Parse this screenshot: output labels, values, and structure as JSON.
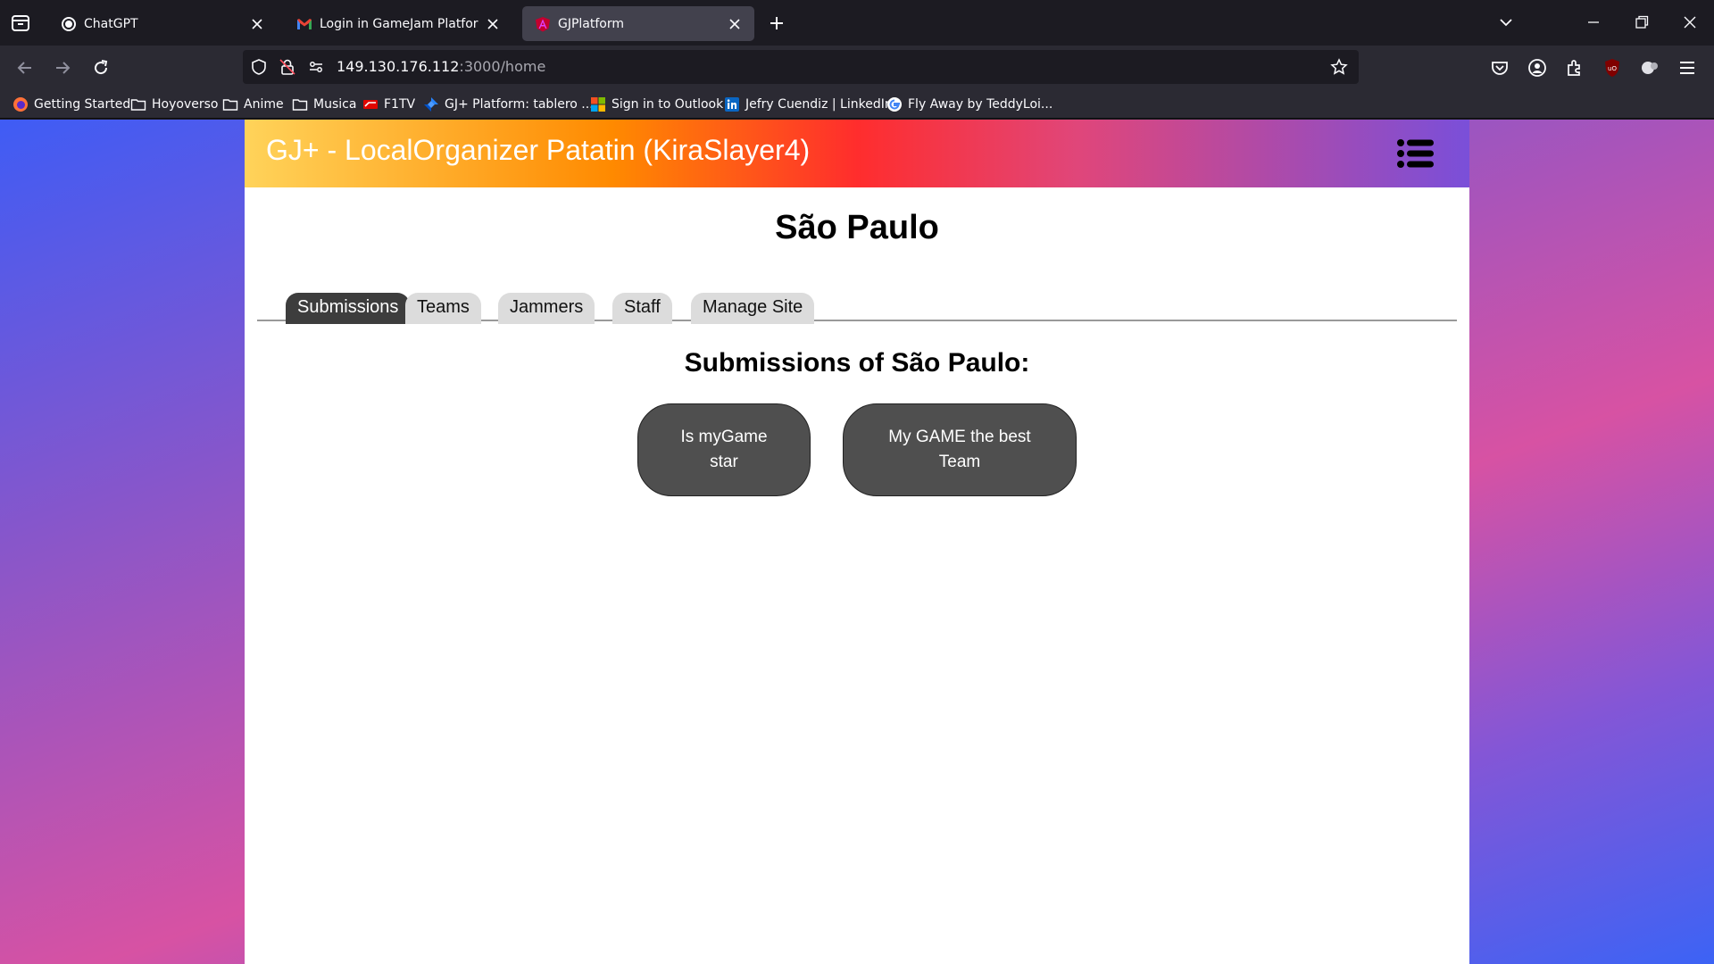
{
  "browser": {
    "tabs": [
      {
        "title": "ChatGPT",
        "active": false
      },
      {
        "title": "Login in GameJam Platform - je",
        "active": false
      },
      {
        "title": "GJPlatform",
        "active": true
      }
    ],
    "url": {
      "host": "149.130.176.112",
      "rest": ":3000/home"
    },
    "bookmarks": [
      {
        "label": "Getting Started",
        "icon": "firefox-icon"
      },
      {
        "label": "Hoyoverso",
        "icon": "folder-icon"
      },
      {
        "label": "Anime",
        "icon": "folder-icon"
      },
      {
        "label": "Musica",
        "icon": "folder-icon"
      },
      {
        "label": "F1TV",
        "icon": "f1tv-icon"
      },
      {
        "label": "GJ+ Platform: tablero ...",
        "icon": "jira-icon"
      },
      {
        "label": "Sign in to Outlook",
        "icon": "microsoft-icon"
      },
      {
        "label": "Jefry Cuendiz | LinkedIn",
        "icon": "linkedin-icon"
      },
      {
        "label": "Fly Away by TeddyLoi...",
        "icon": "google-icon"
      }
    ]
  },
  "page": {
    "header_title": "GJ+ - LocalOrganizer Patatin (KiraSlayer4)",
    "site_title": "São Paulo",
    "tabs": [
      {
        "label": "Submissions",
        "active": true
      },
      {
        "label": "Teams",
        "active": false
      },
      {
        "label": "Jammers",
        "active": false
      },
      {
        "label": "Staff",
        "active": false
      },
      {
        "label": "Manage Site",
        "active": false
      }
    ],
    "section_title": "Submissions of São Paulo:",
    "submissions": [
      {
        "name": "Is myGame star"
      },
      {
        "name": "My GAME the best Team"
      }
    ]
  },
  "colors": {
    "header_gradient": [
      "#ffd35a",
      "#ff8a00",
      "#ff2d2d",
      "#e0467a",
      "#7a4fd9"
    ],
    "active_tab": "#3d3d3d",
    "inactive_tab": "#dcdcdc",
    "card": "#4f4f4f"
  }
}
